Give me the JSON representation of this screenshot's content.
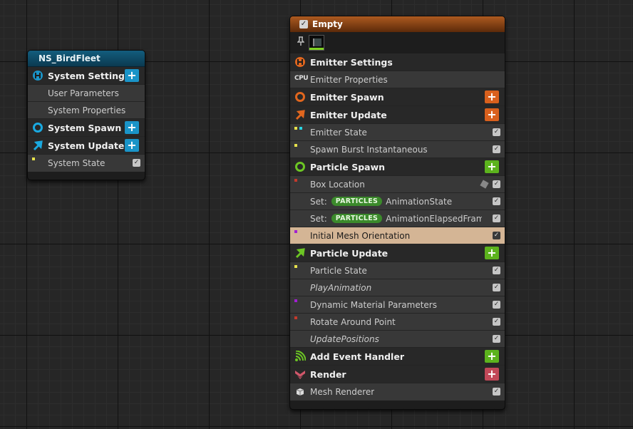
{
  "system_node": {
    "title": "NS_BirdFleet",
    "rows": [
      {
        "label": "System Settings",
        "kind": "header",
        "icon": "settings-icon",
        "has_add": true
      },
      {
        "label": "User Parameters",
        "kind": "item"
      },
      {
        "label": "System Properties",
        "kind": "item"
      },
      {
        "label": "System Spawn",
        "kind": "header",
        "icon": "spawn-ring-icon",
        "has_add": true
      },
      {
        "label": "System Update",
        "kind": "header",
        "icon": "update-arrow-icon",
        "has_add": true
      },
      {
        "label": "System State",
        "kind": "item",
        "checked": true
      }
    ]
  },
  "emitter_node": {
    "title": "Empty",
    "enabled": true,
    "rows": [
      {
        "label": "Emitter Settings"
      },
      {
        "label": "Emitter Properties",
        "icon_text": "CPU"
      },
      {
        "label": "Emitter Spawn"
      },
      {
        "label": "Emitter Update"
      },
      {
        "label": "Emitter State"
      },
      {
        "label": "Spawn Burst Instantaneous"
      },
      {
        "label": "Particle Spawn"
      },
      {
        "label": "Box Location"
      },
      {
        "prefix": "Set:",
        "badge": "PARTICLES",
        "label": "AnimationState"
      },
      {
        "prefix": "Set:",
        "badge": "PARTICLES",
        "label": "AnimationElapsedFrames"
      },
      {
        "label": "Initial Mesh Orientation",
        "selected": true
      },
      {
        "label": "Particle Update"
      },
      {
        "label": "Particle State"
      },
      {
        "label": "PlayAnimation"
      },
      {
        "label": "Dynamic Material Parameters"
      },
      {
        "label": "Rotate Around Point"
      },
      {
        "label": "UpdatePositions"
      },
      {
        "label": "Add Event Handler"
      },
      {
        "label": "Render"
      },
      {
        "label": "Mesh Renderer"
      }
    ]
  },
  "colors": {
    "system_accent": "#1a94c8",
    "emitter_accent": "#d9601d",
    "particle_accent": "#5cb31d",
    "render_accent": "#c24858",
    "selected_row": "#d4b595"
  }
}
